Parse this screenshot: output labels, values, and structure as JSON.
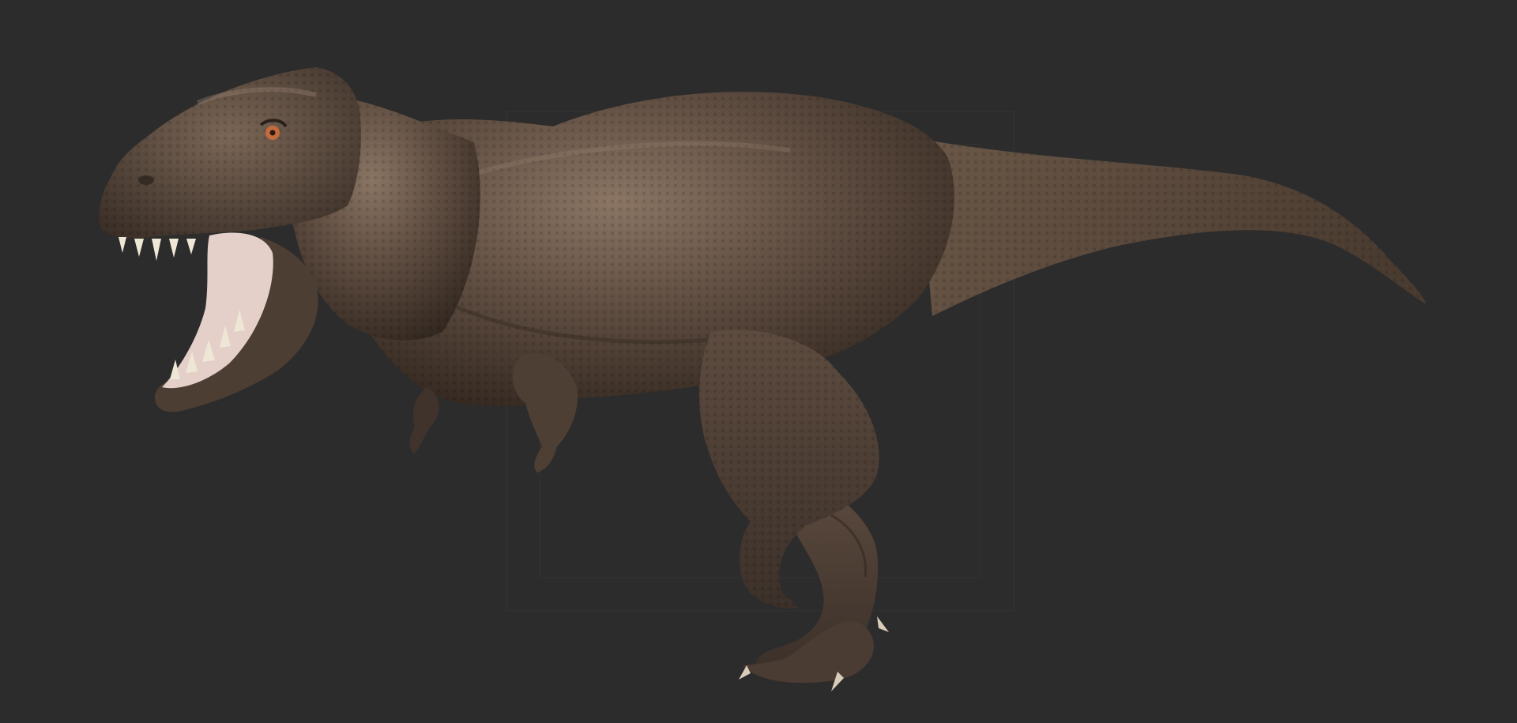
{
  "scene": {
    "background_color": "#2c2c2c",
    "subject": "tyrannosaurus-rex-3d-render",
    "skin_colors": {
      "base": "#5a4a3e",
      "dark": "#3a2e26",
      "light": "#8a7564",
      "highlight": "#a08a78",
      "mouth": "#e8d6cf",
      "teeth": "#efe7d6",
      "eye": "#c46a3c"
    }
  }
}
